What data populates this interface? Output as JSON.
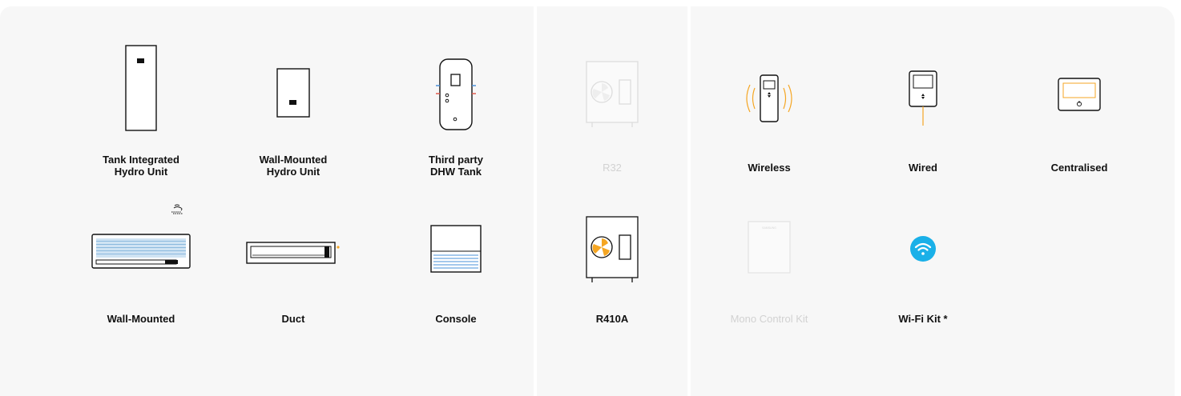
{
  "indoor_units": {
    "row1": [
      {
        "line1": "Tank Integrated",
        "line2": "Hydro Unit",
        "icon": "tank-integrated-hydro-unit-icon"
      },
      {
        "line1": "Wall-Mounted",
        "line2": "Hydro Unit",
        "icon": "wall-mounted-hydro-unit-icon"
      },
      {
        "line1": "Third party",
        "line2": "DHW Tank",
        "icon": "dhw-tank-icon"
      }
    ],
    "row2": [
      {
        "label": "Wall-Mounted",
        "icon": "wall-mounted-ac-icon"
      },
      {
        "label": "Duct",
        "icon": "duct-ac-icon"
      },
      {
        "label": "Console",
        "icon": "console-ac-icon"
      }
    ]
  },
  "outdoor_units": [
    {
      "label": "R32",
      "state": "disabled",
      "icon": "outdoor-unit-icon"
    },
    {
      "label": "R410A",
      "state": "active",
      "icon": "outdoor-unit-icon"
    }
  ],
  "controls": {
    "row1": [
      {
        "label": "Wireless",
        "icon": "wireless-remote-icon"
      },
      {
        "label": "Wired",
        "icon": "wired-remote-icon"
      },
      {
        "label": "Centralised",
        "icon": "centralised-controller-icon"
      }
    ],
    "row2": [
      {
        "label": "Mono Control Kit",
        "state": "disabled",
        "icon": "mono-control-kit-icon",
        "brand_text": "SAMSUNG"
      },
      {
        "label": "Wi-Fi Kit *",
        "state": "active",
        "icon": "wifi-icon"
      }
    ]
  },
  "colors": {
    "panel": "#f7f7f7",
    "text": "#111111",
    "muted": "#d2d2d2",
    "accent_orange": "#f5a623",
    "wifi_blue": "#1ab0e8",
    "stripe_blue": "#4a90d9"
  }
}
